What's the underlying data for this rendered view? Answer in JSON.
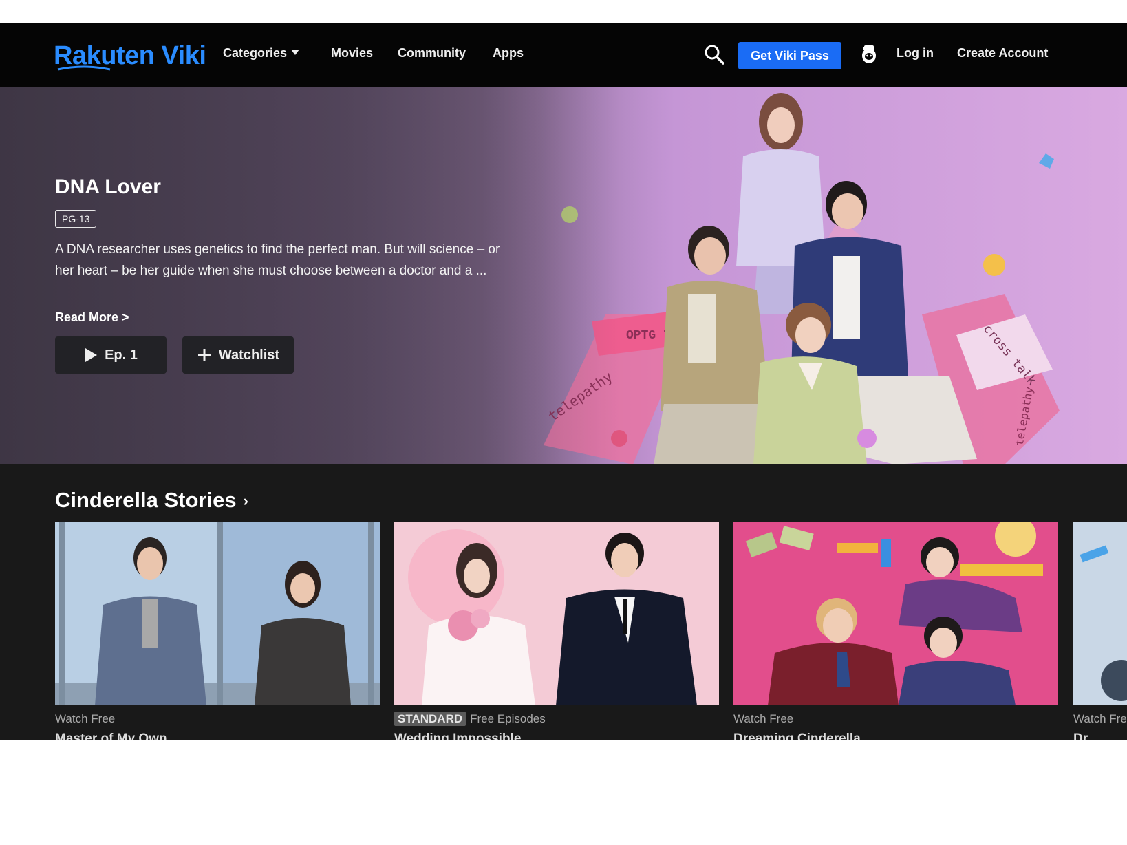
{
  "nav": {
    "logo": "Rakuten Viki",
    "categories": "Categories",
    "movies": "Movies",
    "community": "Community",
    "apps": "Apps",
    "viki_pass": "Get Viki Pass",
    "login": "Log in",
    "create_account": "Create Account"
  },
  "hero": {
    "title": "DNA Lover",
    "rating": "PG-13",
    "description": "A DNA researcher uses genetics to find the perfect man. But will science – or her heart – be her guide when she must choose between a doctor and a ...",
    "read_more": "Read More >",
    "play_label": "Ep. 1",
    "watchlist_label": "Watchlist",
    "art_text": [
      "OPTG 7",
      "telepathy",
      "cross talk",
      "telepathy"
    ]
  },
  "row": {
    "title": "Cinderella Stories",
    "chevron": "›",
    "cards": [
      {
        "badge": "",
        "meta": "Watch Free",
        "title": "Master of My Own"
      },
      {
        "badge": "STANDARD",
        "meta": "Free Episodes",
        "title": "Wedding Impossible"
      },
      {
        "badge": "",
        "meta": "Watch Free",
        "title": "Dreaming Cinderella"
      },
      {
        "badge": "",
        "meta": "Watch Free",
        "title": "Dr"
      }
    ]
  },
  "colors": {
    "accent": "#1a6cf5",
    "nav_bg": "#050505",
    "page_bg": "#191919"
  },
  "icons": [
    "search-icon",
    "caret-down-icon",
    "mascot-icon",
    "play-icon",
    "plus-icon",
    "chevron-right-icon"
  ]
}
